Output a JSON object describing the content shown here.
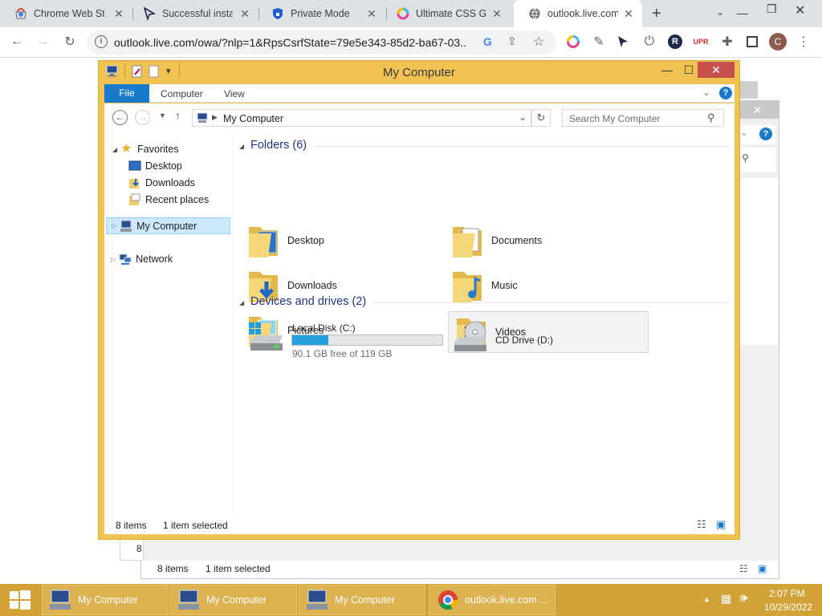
{
  "browser": {
    "tabs": [
      {
        "title": "Chrome Web Sto",
        "icon": "chrome-webstore-icon"
      },
      {
        "title": "Successful installa",
        "icon": "cursor-arrow-icon"
      },
      {
        "title": "Private Mode",
        "icon": "shield-icon"
      },
      {
        "title": "Ultimate CSS Gra",
        "icon": "gradient-ring-icon"
      },
      {
        "title": "outlook.live.com",
        "icon": "globe-icon"
      }
    ],
    "new_tab_label": "+",
    "address": "outlook.live.com/owa/?nlp=1&RpsCsrfState=79e5e343-85d2-ba67-03...",
    "profile_initial": "C",
    "ext_badge": "UPR"
  },
  "explorer": {
    "title": "My Computer",
    "ribbon_tabs": {
      "file": "File",
      "computer": "Computer",
      "view": "View"
    },
    "address": "My Computer",
    "search_placeholder": "Search My Computer",
    "nav": {
      "favorites": "Favorites",
      "desktop": "Desktop",
      "downloads": "Downloads",
      "recent": "Recent places",
      "my_computer": "My Computer",
      "network": "Network"
    },
    "folders_header": "Folders (6)",
    "folders": [
      "Desktop",
      "Documents",
      "Downloads",
      "Music",
      "Pictures",
      "Videos"
    ],
    "devices_header": "Devices and drives (2)",
    "drives": {
      "c_name": "Local Disk (C:)",
      "c_free": "90.1 GB free of 119 GB",
      "c_used_fraction": 0.243,
      "d_name": "CD Drive (D:)"
    },
    "status": {
      "items": "8 items",
      "selected": "1 item selected"
    }
  },
  "bg_window": {
    "status": {
      "items": "8 items",
      "selected": "1 item selected"
    },
    "peek_digit": "8"
  },
  "taskbar": {
    "buttons": [
      "My Computer",
      "My Computer",
      "My Computer",
      "outlook.live.com ..."
    ],
    "time": "2:07 PM",
    "date": "10/29/2022"
  },
  "colors": {
    "accent_title": "#f0c252",
    "file_tab": "#1979ca",
    "taskbar": "#d2a336",
    "close": "#c7504f"
  }
}
